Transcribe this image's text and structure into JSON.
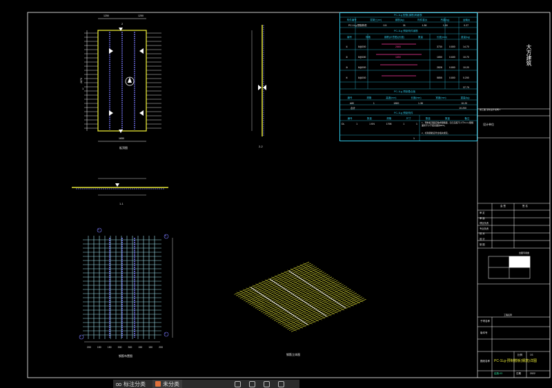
{
  "views": {
    "plan_label": "板顶图",
    "section_22_label": "2-2",
    "section_11_label": "1-1",
    "rebar_plan_label": "钢筋布置图",
    "iso_label": "钢筋立体图",
    "plan_dim_top_left": "1250",
    "plan_dim_top_right": "1250",
    "plan_dim_bottom": "1650",
    "plan_dim_height": "2870",
    "section_mark_1": "1",
    "section_mark_2": "2",
    "axis_a": "A",
    "axis_b": "B",
    "axis_1": "1",
    "axis_2": "2",
    "bottom_dims": [
      "200",
      "150",
      "150",
      "300",
      "300",
      "150",
      "150",
      "200"
    ]
  },
  "table": {
    "title1": "PC-1Lg 配筋(钢筋)明细表",
    "header1": [
      "构件编号",
      "混凝土(m³)",
      "钢筋(kg)",
      "构件重(t)",
      "吊重(kg)",
      "运输(t)"
    ],
    "row1": [
      "PC-1Lg-预制构件",
      "0.5",
      "31",
      "1.38",
      "1.50",
      "0.27"
    ],
    "title2": "PC-1Lg 预制构件钢筋",
    "header2": [
      "编号",
      "规格",
      "钢筋(示意图)(长度)",
      "数量",
      "长度(mm)",
      "重量(kg)"
    ],
    "rows2": [
      [
        "①",
        "8@200",
        "2865",
        "3730",
        "0.800",
        "14.70"
      ],
      [
        "②",
        "8@150",
        "1650",
        "1650",
        "0.600",
        "10.70"
      ],
      [
        "③",
        "8@200",
        "",
        "2828",
        "0.800",
        "10.20"
      ],
      [
        "④",
        "8@200",
        "",
        "5855",
        "0.800",
        "0.200"
      ]
    ],
    "total2": "37.70",
    "title3": "PC-1Lg 预制叠合板",
    "header3": [
      "编号",
      "规格",
      "高度(mm)",
      "长度(mm)",
      "宽度(mm)",
      "重量(kg)"
    ],
    "row3": [
      "A80",
      "1",
      "1800",
      "1.38",
      "",
      "10.20"
    ],
    "row3b": [
      "合计",
      "",
      "",
      "",
      "",
      "10.200"
    ],
    "title4": "PC-1Lg 预制构件",
    "header4": [
      "编号",
      "数量",
      "规格",
      "尺寸",
      "数量",
      "数量",
      "备注"
    ],
    "row4": [
      "DL",
      "1",
      "1 KN",
      "1798",
      "1",
      "1",
      "1、预制板顶面应做成粗糙面，凹凸深度不小于4mm,粗糙面积不小于结合面的80%。"
    ],
    "note_line2": "2、桁架钢筋应符合相关规定。",
    "row4b_qty": "1"
  },
  "title_block": {
    "company": "大方建筑",
    "left_note": "施工图 深化设计说明 1",
    "design_unit": "设计单位",
    "row_labels": [
      "审 定",
      "审 核",
      "项目负责",
      "专业负责",
      "校 对",
      "设 计",
      "制 图"
    ],
    "col_a": "会 签",
    "col_b": "签 名",
    "stamp": "出图专用章",
    "sheet_label": "图纸名称",
    "page": "1/1",
    "scale": "比例",
    "drawing_name": "PC-1Lg-预制楼板(钢筋)详图",
    "date_label": "日期",
    "date_value": "2022",
    "code": "结施-03",
    "proj": "工程名称",
    "subproj": "子项名称",
    "check": "版本号"
  },
  "statusbar": {
    "tab1": "标注分类",
    "tab2": "未分类"
  },
  "colors": {
    "rebar_yellow": "#e6e635",
    "rebar_cyan": "#2fc7e6",
    "rebar_blue": "#7a7aff",
    "frame": "#ffffff",
    "pink": "#ff3aa0"
  }
}
